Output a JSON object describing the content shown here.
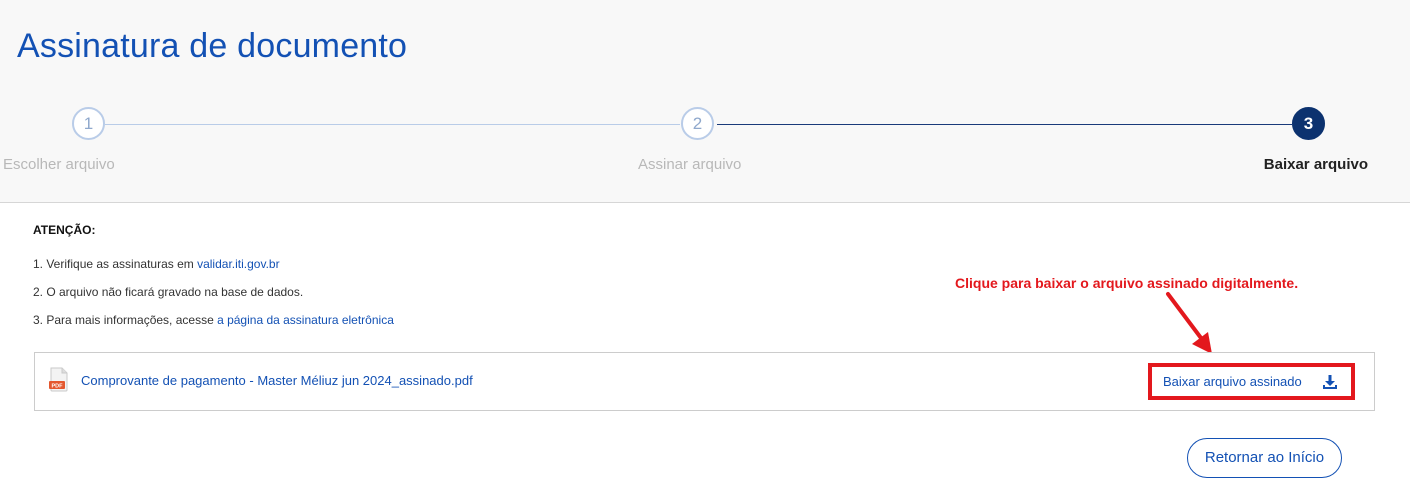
{
  "page": {
    "title": "Assinatura de documento"
  },
  "stepper": {
    "steps": [
      {
        "number": "1",
        "label": "Escolher arquivo",
        "state": "inactive"
      },
      {
        "number": "2",
        "label": "Assinar arquivo",
        "state": "inactive"
      },
      {
        "number": "3",
        "label": "Baixar arquivo",
        "state": "active"
      }
    ]
  },
  "notice": {
    "heading": "ATENÇÃO:",
    "items": [
      {
        "text": "1. Verifique as assinaturas em ",
        "link": "validar.iti.gov.br"
      },
      {
        "text": "2. O arquivo não ficará gravado na base de dados."
      },
      {
        "text": "3. Para mais informações, acesse ",
        "link": "a página da assinatura eletrônica"
      }
    ]
  },
  "file": {
    "icon": "pdf-icon",
    "icon_text": "PDF",
    "name": "Comprovante de pagamento - Master Méliuz jun 2024_assinado.pdf",
    "download_label": "Baixar arquivo assinado",
    "download_icon": "download-icon"
  },
  "annotation": {
    "text": "Clique para baixar o arquivo assinado digitalmente.",
    "color": "#e3181d"
  },
  "actions": {
    "return_label": "Retornar ao Início"
  },
  "colors": {
    "primary": "#1351b4",
    "active_step": "#0c326f",
    "highlight": "#e3181d"
  }
}
